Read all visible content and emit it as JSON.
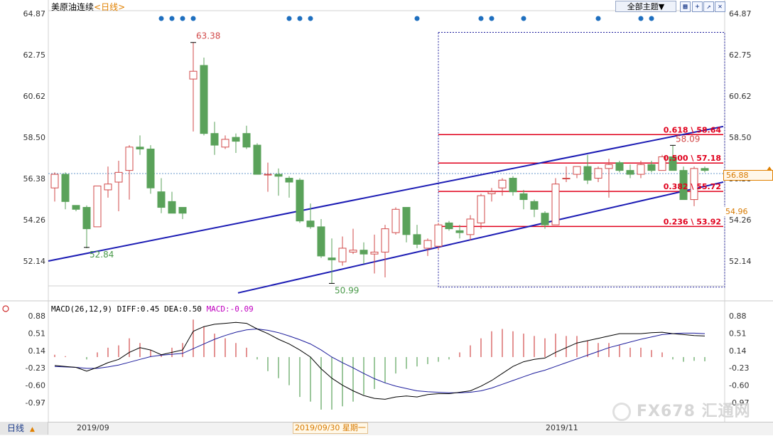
{
  "header": {
    "title": "美原油连续",
    "period": "<日线>",
    "topic_button": "全部主题▼",
    "tool_icons": [
      "grid-icon",
      "cross-icon",
      "line-icon",
      "close-icon"
    ]
  },
  "price_tags": {
    "current": "56.88",
    "low": "54.96"
  },
  "macd": {
    "label": "MACD(26,12,9)",
    "diff_label": "DIFF:0.45",
    "dea_label": "DEA:0.50",
    "macd_label": "MACD:-0.09"
  },
  "footer": {
    "period_tab": "日线",
    "dates": [
      "2019/09",
      "2019/11"
    ],
    "cursor_date": "2019/09/30 星期一"
  },
  "watermark": "FX678 汇通网",
  "colors": {
    "up": "#d24a4a",
    "down": "#5aa25a",
    "channel": "#1c1cb4",
    "fib": "#e0001c",
    "diff_line": "#000000",
    "dea_line": "#1c1c9c",
    "dots": "#1e6fbf"
  },
  "chart_data": [
    {
      "type": "candlestick",
      "title": "美原油连续<日线>",
      "ylim": [
        50.0,
        65.0
      ],
      "y_ticks": [
        64.87,
        62.75,
        60.62,
        58.5,
        56.38,
        54.26,
        52.14
      ],
      "x_ticks": [
        "2019/09",
        "2019/11"
      ],
      "candles": [
        {
          "o": 55.9,
          "h": 56.7,
          "l": 55.2,
          "c": 56.6
        },
        {
          "o": 56.6,
          "h": 56.7,
          "l": 54.8,
          "c": 55.2
        },
        {
          "o": 55.0,
          "h": 55.0,
          "l": 54.7,
          "c": 54.8
        },
        {
          "o": 54.9,
          "h": 55.0,
          "l": 52.8,
          "c": 53.8
        },
        {
          "o": 53.9,
          "h": 56.0,
          "l": 53.9,
          "c": 56.0
        },
        {
          "o": 55.8,
          "h": 57.0,
          "l": 55.4,
          "c": 56.1
        },
        {
          "o": 56.2,
          "h": 57.3,
          "l": 54.7,
          "c": 56.7
        },
        {
          "o": 56.8,
          "h": 58.1,
          "l": 55.3,
          "c": 58.0
        },
        {
          "o": 58.0,
          "h": 58.6,
          "l": 57.6,
          "c": 57.9
        },
        {
          "o": 57.9,
          "h": 58.1,
          "l": 55.6,
          "c": 55.9
        },
        {
          "o": 55.7,
          "h": 56.4,
          "l": 54.6,
          "c": 54.9
        },
        {
          "o": 55.2,
          "h": 55.7,
          "l": 54.6,
          "c": 54.6
        },
        {
          "o": 54.9,
          "h": 54.9,
          "l": 54.3,
          "c": 54.6
        },
        {
          "o": 61.5,
          "h": 63.38,
          "l": 58.8,
          "c": 61.9
        },
        {
          "o": 62.2,
          "h": 62.6,
          "l": 58.6,
          "c": 58.7
        },
        {
          "o": 58.7,
          "h": 59.3,
          "l": 57.6,
          "c": 58.1
        },
        {
          "o": 58.0,
          "h": 58.6,
          "l": 57.9,
          "c": 58.4
        },
        {
          "o": 58.5,
          "h": 58.7,
          "l": 57.7,
          "c": 58.3
        },
        {
          "o": 58.7,
          "h": 59.1,
          "l": 57.9,
          "c": 58.0
        },
        {
          "o": 58.1,
          "h": 58.2,
          "l": 56.7,
          "c": 56.6
        },
        {
          "o": 56.6,
          "h": 57.2,
          "l": 55.7,
          "c": 56.6
        },
        {
          "o": 56.6,
          "h": 56.9,
          "l": 55.5,
          "c": 56.5
        },
        {
          "o": 56.4,
          "h": 56.5,
          "l": 55.4,
          "c": 56.2
        },
        {
          "o": 56.3,
          "h": 56.4,
          "l": 54.1,
          "c": 54.2
        },
        {
          "o": 54.2,
          "h": 55.1,
          "l": 53.8,
          "c": 53.9
        },
        {
          "o": 53.9,
          "h": 54.3,
          "l": 52.3,
          "c": 52.4
        },
        {
          "o": 52.3,
          "h": 53.3,
          "l": 51.0,
          "c": 52.2
        },
        {
          "o": 52.1,
          "h": 53.4,
          "l": 51.9,
          "c": 52.8
        },
        {
          "o": 52.6,
          "h": 53.8,
          "l": 52.5,
          "c": 52.7
        },
        {
          "o": 52.7,
          "h": 53.1,
          "l": 52.0,
          "c": 52.5
        },
        {
          "o": 52.5,
          "h": 53.5,
          "l": 51.5,
          "c": 52.6
        },
        {
          "o": 52.6,
          "h": 54.0,
          "l": 51.3,
          "c": 53.8
        },
        {
          "o": 53.6,
          "h": 54.9,
          "l": 53.5,
          "c": 54.8
        },
        {
          "o": 54.9,
          "h": 54.9,
          "l": 53.1,
          "c": 53.5
        },
        {
          "o": 53.5,
          "h": 54.0,
          "l": 52.8,
          "c": 53.0
        },
        {
          "o": 52.8,
          "h": 53.3,
          "l": 52.4,
          "c": 53.2
        },
        {
          "o": 52.9,
          "h": 54.1,
          "l": 52.7,
          "c": 54.0
        },
        {
          "o": 54.1,
          "h": 54.2,
          "l": 53.7,
          "c": 53.8
        },
        {
          "o": 53.7,
          "h": 54.0,
          "l": 53.3,
          "c": 53.6
        },
        {
          "o": 53.5,
          "h": 54.5,
          "l": 53.2,
          "c": 54.3
        },
        {
          "o": 54.1,
          "h": 55.6,
          "l": 53.8,
          "c": 55.5
        },
        {
          "o": 55.6,
          "h": 55.9,
          "l": 55.2,
          "c": 55.7
        },
        {
          "o": 55.9,
          "h": 56.4,
          "l": 55.5,
          "c": 56.3
        },
        {
          "o": 56.4,
          "h": 56.5,
          "l": 55.5,
          "c": 55.7
        },
        {
          "o": 55.6,
          "h": 55.8,
          "l": 54.8,
          "c": 55.3
        },
        {
          "o": 55.2,
          "h": 55.3,
          "l": 54.4,
          "c": 54.8
        },
        {
          "o": 54.6,
          "h": 54.7,
          "l": 53.8,
          "c": 54.0
        },
        {
          "o": 54.0,
          "h": 56.4,
          "l": 54.0,
          "c": 56.1
        },
        {
          "o": 56.4,
          "h": 57.0,
          "l": 56.2,
          "c": 56.4
        },
        {
          "o": 56.6,
          "h": 57.0,
          "l": 56.4,
          "c": 57.0
        },
        {
          "o": 57.0,
          "h": 57.6,
          "l": 56.1,
          "c": 56.3
        },
        {
          "o": 56.4,
          "h": 57.0,
          "l": 56.2,
          "c": 56.9
        },
        {
          "o": 56.9,
          "h": 57.4,
          "l": 55.4,
          "c": 57.1
        },
        {
          "o": 57.2,
          "h": 57.3,
          "l": 56.7,
          "c": 56.8
        },
        {
          "o": 56.8,
          "h": 57.1,
          "l": 56.4,
          "c": 56.6
        },
        {
          "o": 56.6,
          "h": 57.3,
          "l": 56.4,
          "c": 57.1
        },
        {
          "o": 57.1,
          "h": 57.3,
          "l": 56.7,
          "c": 56.8
        },
        {
          "o": 56.8,
          "h": 57.6,
          "l": 56.8,
          "c": 57.5
        },
        {
          "o": 57.5,
          "h": 58.09,
          "l": 56.8,
          "c": 56.8
        },
        {
          "o": 56.8,
          "h": 57.0,
          "l": 55.3,
          "c": 55.3
        },
        {
          "o": 55.3,
          "h": 57.0,
          "l": 54.96,
          "c": 56.9
        },
        {
          "o": 56.9,
          "h": 57.0,
          "l": 56.7,
          "c": 56.8
        }
      ],
      "annotations": [
        {
          "text": "63.38",
          "bar": 13,
          "value": 63.38,
          "color": "up"
        },
        {
          "text": "52.84",
          "bar": 3,
          "value": 52.84,
          "color": "down"
        },
        {
          "text": "50.99",
          "bar": 26,
          "value": 50.99,
          "color": "down"
        },
        {
          "text": "58.09",
          "bar": 58,
          "value": 58.09,
          "color": "up"
        }
      ],
      "fibonacci": [
        {
          "label": "0.618 \\ 58.64",
          "value": 58.64
        },
        {
          "label": "0.500 \\ 57.18",
          "value": 57.18
        },
        {
          "label": "0.382 \\ 55.72",
          "value": 55.72
        },
        {
          "label": "0.236 \\ 53.92",
          "value": 53.92
        }
      ],
      "signal_dots_bars": [
        10,
        11,
        12,
        13,
        22,
        23,
        24,
        34,
        40,
        41,
        44,
        51,
        55,
        56
      ],
      "reference_line": 56.64
    },
    {
      "type": "macd",
      "title": "MACD(26,12,9)",
      "ylim": [
        -1.25,
        1.0
      ],
      "y_ticks": [
        0.88,
        0.51,
        0.14,
        -0.23,
        -0.6,
        -0.97
      ],
      "histogram": [
        0.05,
        0.02,
        0.0,
        -0.05,
        0.1,
        0.2,
        0.25,
        0.4,
        0.3,
        0.15,
        0.05,
        0.2,
        0.3,
        0.8,
        0.65,
        0.5,
        0.4,
        0.3,
        0.2,
        -0.05,
        -0.3,
        -0.45,
        -0.6,
        -0.85,
        -0.95,
        -1.12,
        -1.12,
        -1.05,
        -0.95,
        -0.8,
        -0.68,
        -0.55,
        -0.35,
        -0.25,
        -0.2,
        -0.15,
        -0.1,
        -0.05,
        0.1,
        0.25,
        0.4,
        0.55,
        0.6,
        0.55,
        0.5,
        0.45,
        0.4,
        0.5,
        0.45,
        0.45,
        0.35,
        0.3,
        0.3,
        0.25,
        0.2,
        0.2,
        0.15,
        0.1,
        -0.05,
        -0.1,
        -0.08,
        -0.09
      ],
      "diff": [
        -0.18,
        -0.2,
        -0.22,
        -0.3,
        -0.22,
        -0.12,
        -0.05,
        0.1,
        0.2,
        0.15,
        0.05,
        0.1,
        0.15,
        0.55,
        0.65,
        0.7,
        0.72,
        0.74,
        0.72,
        0.6,
        0.5,
        0.38,
        0.28,
        0.15,
        0.0,
        -0.25,
        -0.45,
        -0.6,
        -0.72,
        -0.82,
        -0.88,
        -0.9,
        -0.85,
        -0.83,
        -0.85,
        -0.8,
        -0.78,
        -0.78,
        -0.75,
        -0.72,
        -0.62,
        -0.5,
        -0.35,
        -0.2,
        -0.1,
        -0.05,
        -0.02,
        0.1,
        0.2,
        0.3,
        0.35,
        0.4,
        0.45,
        0.5,
        0.5,
        0.5,
        0.52,
        0.53,
        0.5,
        0.48,
        0.46,
        0.45
      ],
      "dea": [
        -0.2,
        -0.21,
        -0.22,
        -0.24,
        -0.24,
        -0.21,
        -0.17,
        -0.11,
        -0.05,
        0.01,
        0.04,
        0.06,
        0.08,
        0.18,
        0.28,
        0.38,
        0.46,
        0.53,
        0.58,
        0.6,
        0.57,
        0.52,
        0.45,
        0.37,
        0.28,
        0.15,
        0.0,
        -0.12,
        -0.23,
        -0.35,
        -0.46,
        -0.55,
        -0.62,
        -0.67,
        -0.72,
        -0.74,
        -0.75,
        -0.76,
        -0.76,
        -0.75,
        -0.72,
        -0.66,
        -0.58,
        -0.5,
        -0.42,
        -0.34,
        -0.28,
        -0.2,
        -0.12,
        -0.04,
        0.04,
        0.12,
        0.2,
        0.26,
        0.32,
        0.38,
        0.43,
        0.48,
        0.5,
        0.51,
        0.51,
        0.5
      ]
    }
  ]
}
